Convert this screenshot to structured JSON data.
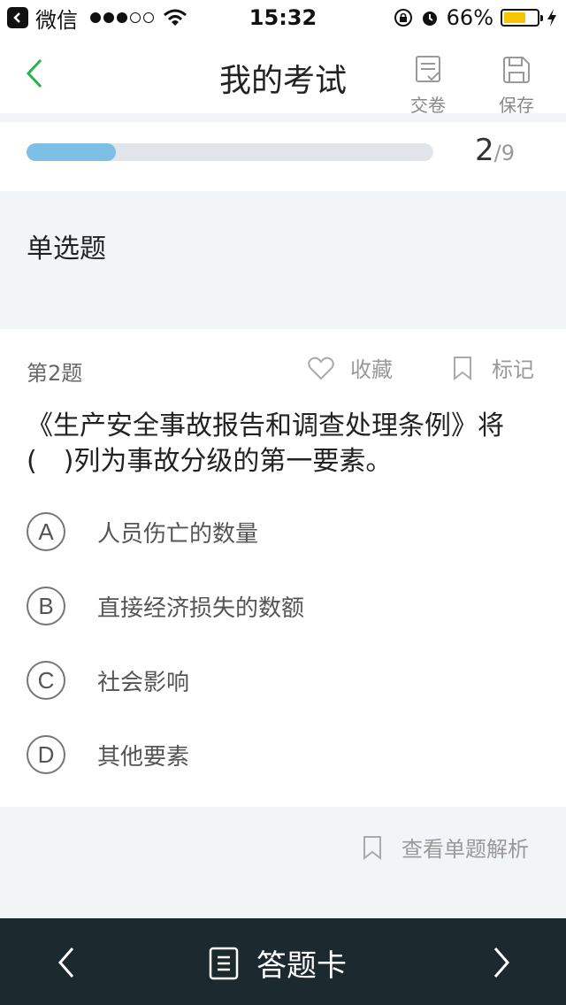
{
  "status_bar": {
    "app": "微信",
    "time": "15:32",
    "battery": "66%",
    "battery_level": 0.66,
    "signal_dots_filled": 3,
    "signal_dots_total": 5
  },
  "nav": {
    "title": "我的考试",
    "submit_label": "交卷",
    "save_label": "保存"
  },
  "progress": {
    "current": "2",
    "total": "/9",
    "fraction": 0.22
  },
  "question_type": "单选题",
  "question": {
    "number": "第2题",
    "favorite_label": "收藏",
    "mark_label": "标记",
    "text": "《生产安全事故报告和调查处理条例》将(　)列为事故分级的第一要素。",
    "options": [
      {
        "letter": "A",
        "text": "人员伤亡的数量"
      },
      {
        "letter": "B",
        "text": "直接经济损失的数额"
      },
      {
        "letter": "C",
        "text": "社会影响"
      },
      {
        "letter": "D",
        "text": "其他要素"
      }
    ]
  },
  "analysis_label": "查看单题解析",
  "bottom": {
    "answer_card_label": "答题卡"
  },
  "colors": {
    "accent_green": "#2bb24c",
    "progress_fill": "#7ec0e5",
    "bottom_bar": "#1c2a30"
  }
}
